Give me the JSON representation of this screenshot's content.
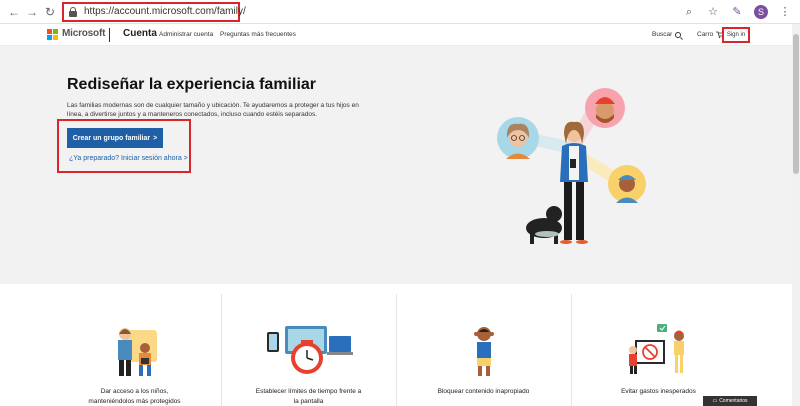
{
  "browser": {
    "url": "https://account.microsoft.com/family/",
    "profile_initial": "S",
    "icons": [
      "back-arrow-icon",
      "forward-arrow-icon",
      "reload-icon",
      "lock-icon",
      "search-icon",
      "star-icon",
      "extension-pen-icon",
      "profile-avatar",
      "kebab-menu-icon"
    ]
  },
  "header": {
    "brand": "Microsoft",
    "section": "Cuenta",
    "nav": [
      "Administrar cuenta",
      "Preguntas más frecuentes"
    ],
    "search_label": "Buscar",
    "cart_label": "Carro",
    "signin_label": "Sign in",
    "logo_colors": [
      "#f25022",
      "#7fba00",
      "#00a4ef",
      "#ffb900"
    ]
  },
  "hero": {
    "title": "Rediseñar la experiencia familiar",
    "description": "Las familias modernas son de cualquier tamaño y ubicación. Te ayudaremos a proteger a tus hijos en línea, a divertirse juntos y a manteneros conectados, incluso cuando estéis separados.",
    "cta_label": "Crear un grupo familiar",
    "cta_arrow": ">",
    "signin_link": "¿Ya preparado? Iniciar sesión ahora",
    "signin_arrow": ">"
  },
  "features": [
    {
      "label_line1": "Dar acceso a los niños,",
      "label_line2": "manteniéndolos más protegidos"
    },
    {
      "label_line1": "Establecer límites de tiempo frente a",
      "label_line2": "la pantalla"
    },
    {
      "label_line1": "Bloquear contenido inapropiado",
      "label_line2": ""
    },
    {
      "label_line1": "Evitar gastos inesperados",
      "label_line2": ""
    }
  ],
  "feedback_label": "Comentarios",
  "colors": {
    "accent": "#1e5fa6",
    "highlight": "#d9262d",
    "hero_bg": "#f2f2f2"
  }
}
